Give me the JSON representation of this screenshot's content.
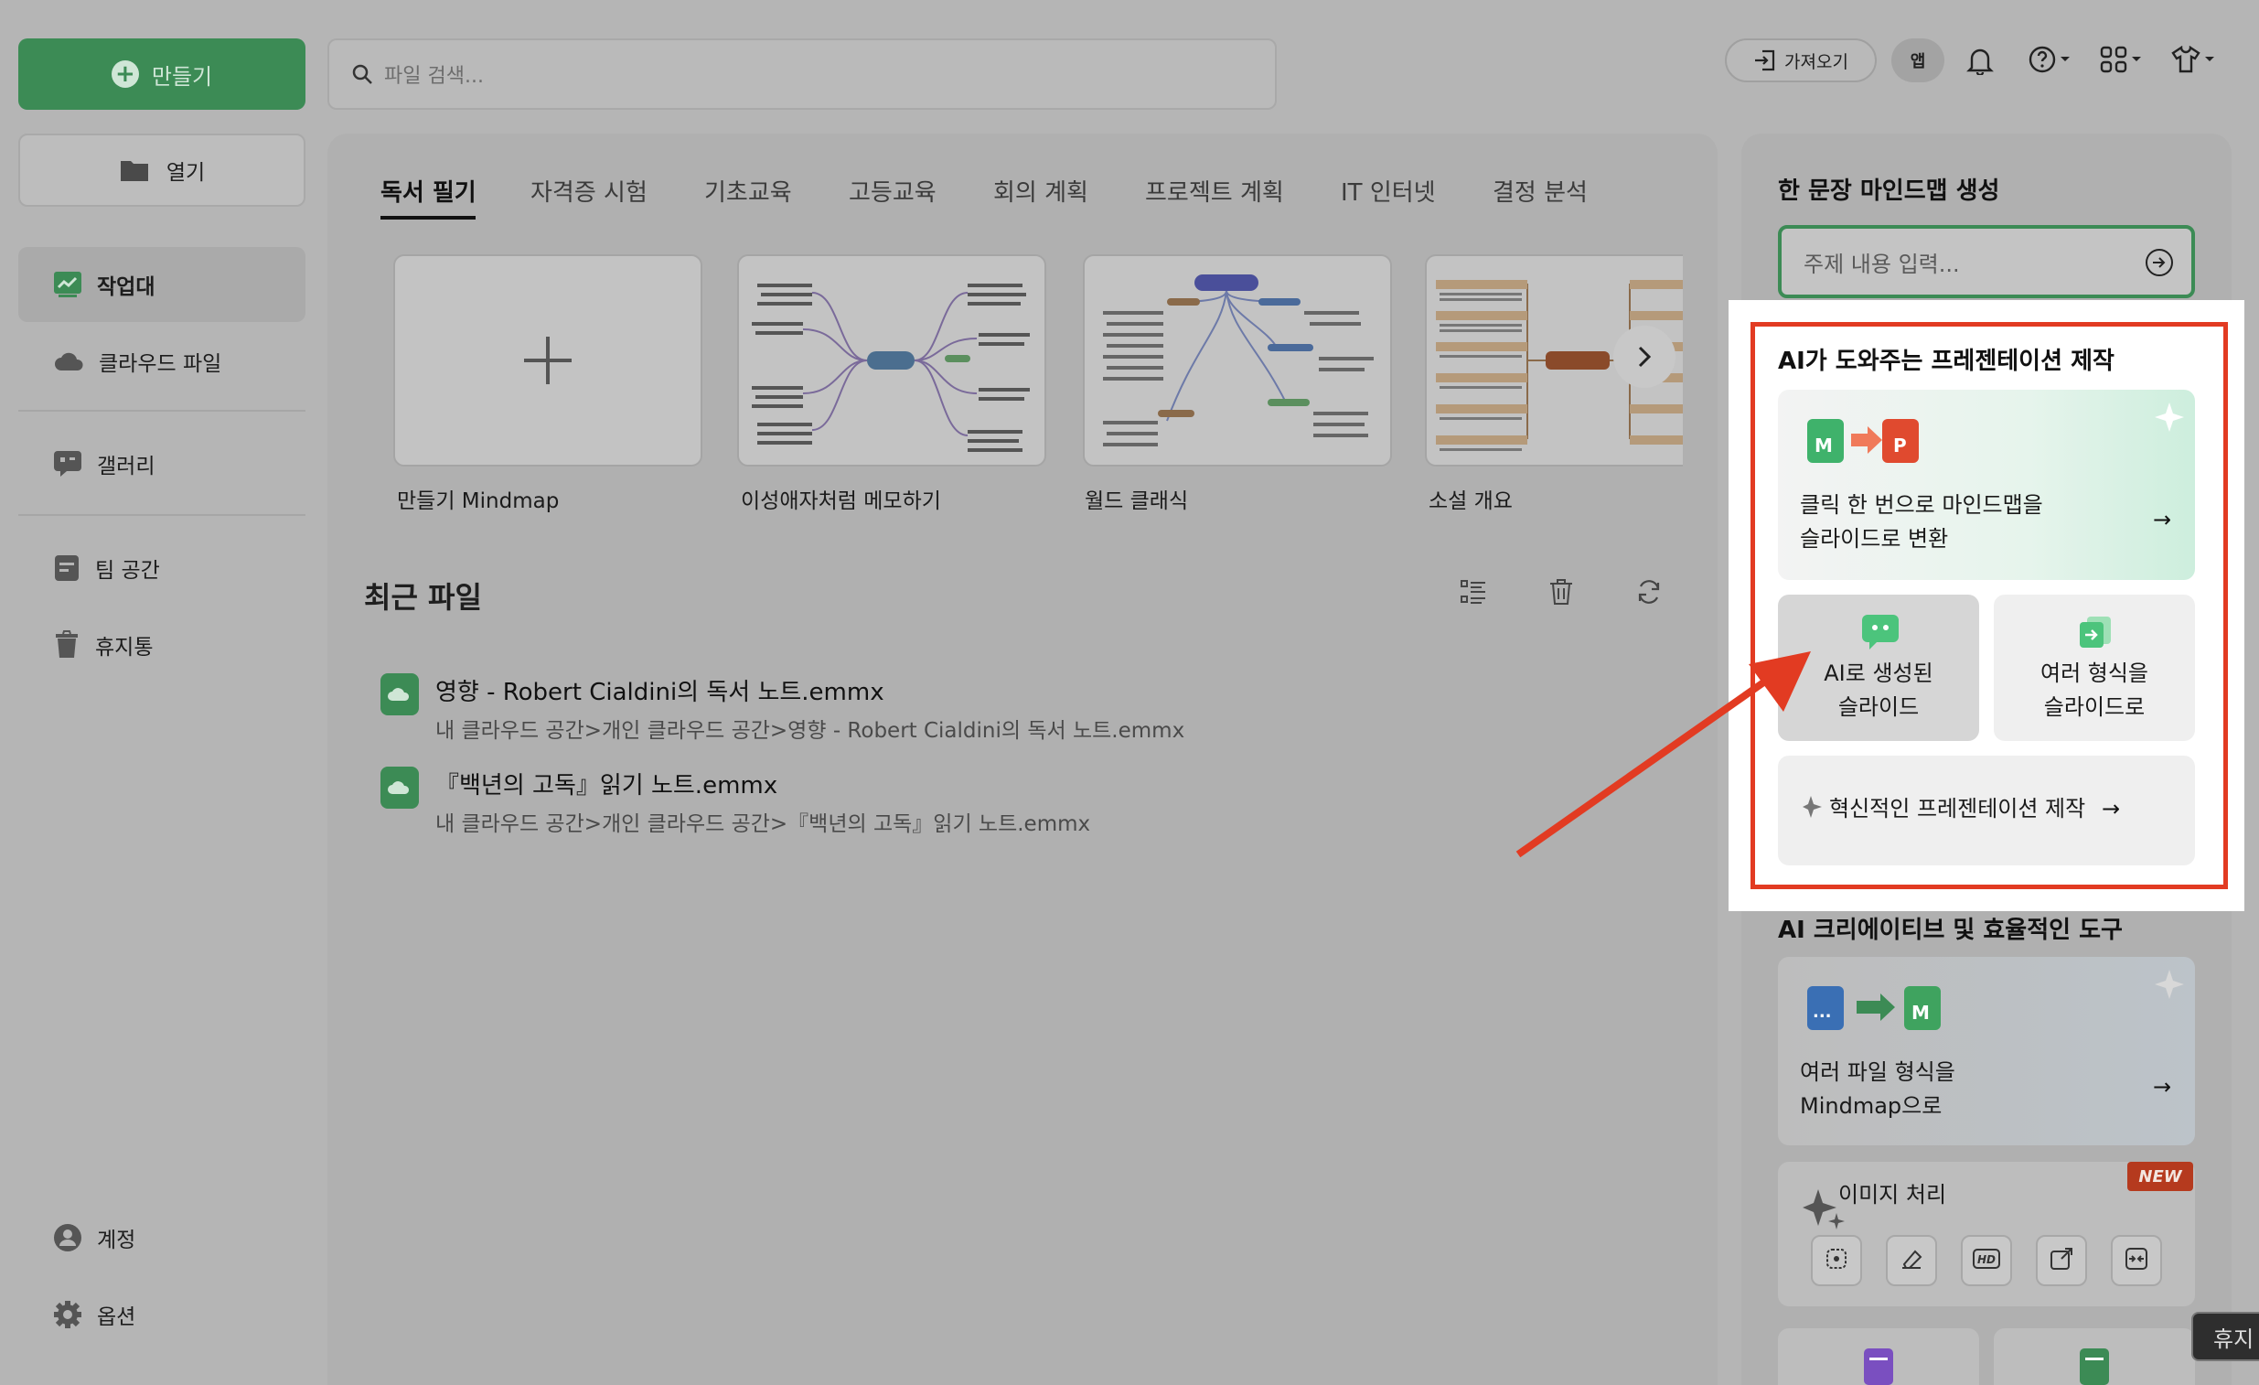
{
  "sidebar": {
    "create_label": "만들기",
    "open_label": "열기",
    "items": [
      {
        "label": "작업대"
      },
      {
        "label": "클라우드 파일"
      },
      {
        "label": "갤러리"
      },
      {
        "label": "팀 공간"
      },
      {
        "label": "휴지통"
      }
    ],
    "bottom": [
      {
        "label": "계정"
      },
      {
        "label": "옵션"
      }
    ]
  },
  "topbar": {
    "search_placeholder": "파일 검색...",
    "import_label": "가져오기",
    "app_label": "앱"
  },
  "tabs": [
    {
      "label": "독서 필기"
    },
    {
      "label": "자격증 시험"
    },
    {
      "label": "기초교육"
    },
    {
      "label": "고등교육"
    },
    {
      "label": "회의 계획"
    },
    {
      "label": "프로젝트 계획"
    },
    {
      "label": "IT 인터넷"
    },
    {
      "label": "결정 분석"
    }
  ],
  "templates": [
    {
      "label": "만들기 Mindmap"
    },
    {
      "label": "이성애자처럼 메모하기"
    },
    {
      "label": "월드 클래식"
    },
    {
      "label": "소설 개요"
    }
  ],
  "recent": {
    "title": "최근 파일",
    "files": [
      {
        "name": "영향 - Robert Cialdini의 독서 노트.emmx",
        "path": "내 클라우드 공간>개인 클라우드 공간>영향 - Robert Cialdini의 독서 노트.emmx"
      },
      {
        "name": "『백년의 고독』읽기 노트.emmx",
        "path": "내 클라우드 공간>개인 클라우드 공간>『백년의 고독』읽기 노트.emmx"
      }
    ]
  },
  "right": {
    "one_sentence_title": "한 문장 마인드맵 생성",
    "topic_placeholder": "주제 내용 입력...",
    "ai_pres_title": "AI가 도와주는 프레젠테이션 제작",
    "convert_line1": "클릭 한 번으로 마인드맵을",
    "convert_line2": "슬라이드로 변환",
    "ai_slides_line1": "AI로 생성된",
    "ai_slides_line2": "슬라이드",
    "multi_line1": "여러 형식을",
    "multi_line2": "슬라이드로",
    "innovative": "혁신적인 프레젠테이션 제작",
    "tools_title": "AI 크리에이티브 및 효율적인 도구",
    "files_to_mm_line1": "여러 파일 형식을",
    "files_to_mm_line2": "Mindmap으로",
    "image_proc": "이미지 처리",
    "new_badge": "NEW",
    "tooltip": "휴지"
  },
  "colors": {
    "accent_green": "#3c8b55",
    "highlight_red": "#e23b22",
    "overlay_gray": "#b0b0b0"
  }
}
